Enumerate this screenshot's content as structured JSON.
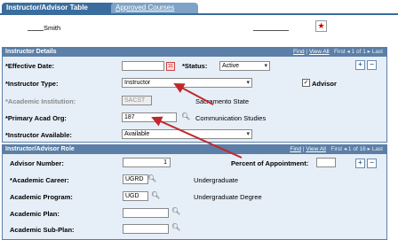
{
  "tabs": [
    {
      "label": "Instructor/Advisor Table"
    },
    {
      "label": "Approved Courses"
    }
  ],
  "header": {
    "name": "Smith"
  },
  "details": {
    "title": "Instructor Details",
    "nav": {
      "find": "Find",
      "view_all": "View All",
      "first": "First",
      "counter": "1 of 1",
      "last": "Last"
    },
    "effective_date_label": "*Effective Date:",
    "effective_date_value": "",
    "status_label": "*Status:",
    "status_value": "Active",
    "instructor_type_label": "*Instructor Type:",
    "instructor_type_value": "Instructor",
    "advisor_label": "Advisor",
    "advisor_checked": true,
    "institution_label": "*Academic Institution:",
    "institution_value": "SACST",
    "institution_desc": "Sacramento State",
    "acad_org_label": "*Primary Acad Org:",
    "acad_org_value": "187",
    "acad_org_desc": "Communication Studies",
    "available_label": "*Instructor Available:",
    "available_value": "Available"
  },
  "role": {
    "title": "Instructor/Advisor Role",
    "nav": {
      "find": "Find",
      "view_all": "View All",
      "first": "First",
      "counter": "1 of 16",
      "last": "Last"
    },
    "advisor_number_label": "Advisor Number:",
    "advisor_number_value": "1",
    "percent_label": "Percent of Appointment:",
    "percent_value": "",
    "career_label": "*Academic Career:",
    "career_value": "UGRD",
    "career_desc": "Undergraduate",
    "program_label": "Academic Program:",
    "program_value": "UGD",
    "program_desc": "Undergraduate Degree",
    "plan_label": "Academic Plan:",
    "plan_value": "",
    "subplan_label": "Academic Sub-Plan:",
    "subplan_value": ""
  },
  "colors": {
    "accent": "#3a6d9e",
    "panel_bg": "#e6eef7",
    "arrow": "#c0282d"
  },
  "icons": [
    "star-icon",
    "calendar-icon",
    "lookup-icon",
    "add-row-icon",
    "delete-row-icon",
    "nav-first-icon",
    "nav-last-icon"
  ]
}
